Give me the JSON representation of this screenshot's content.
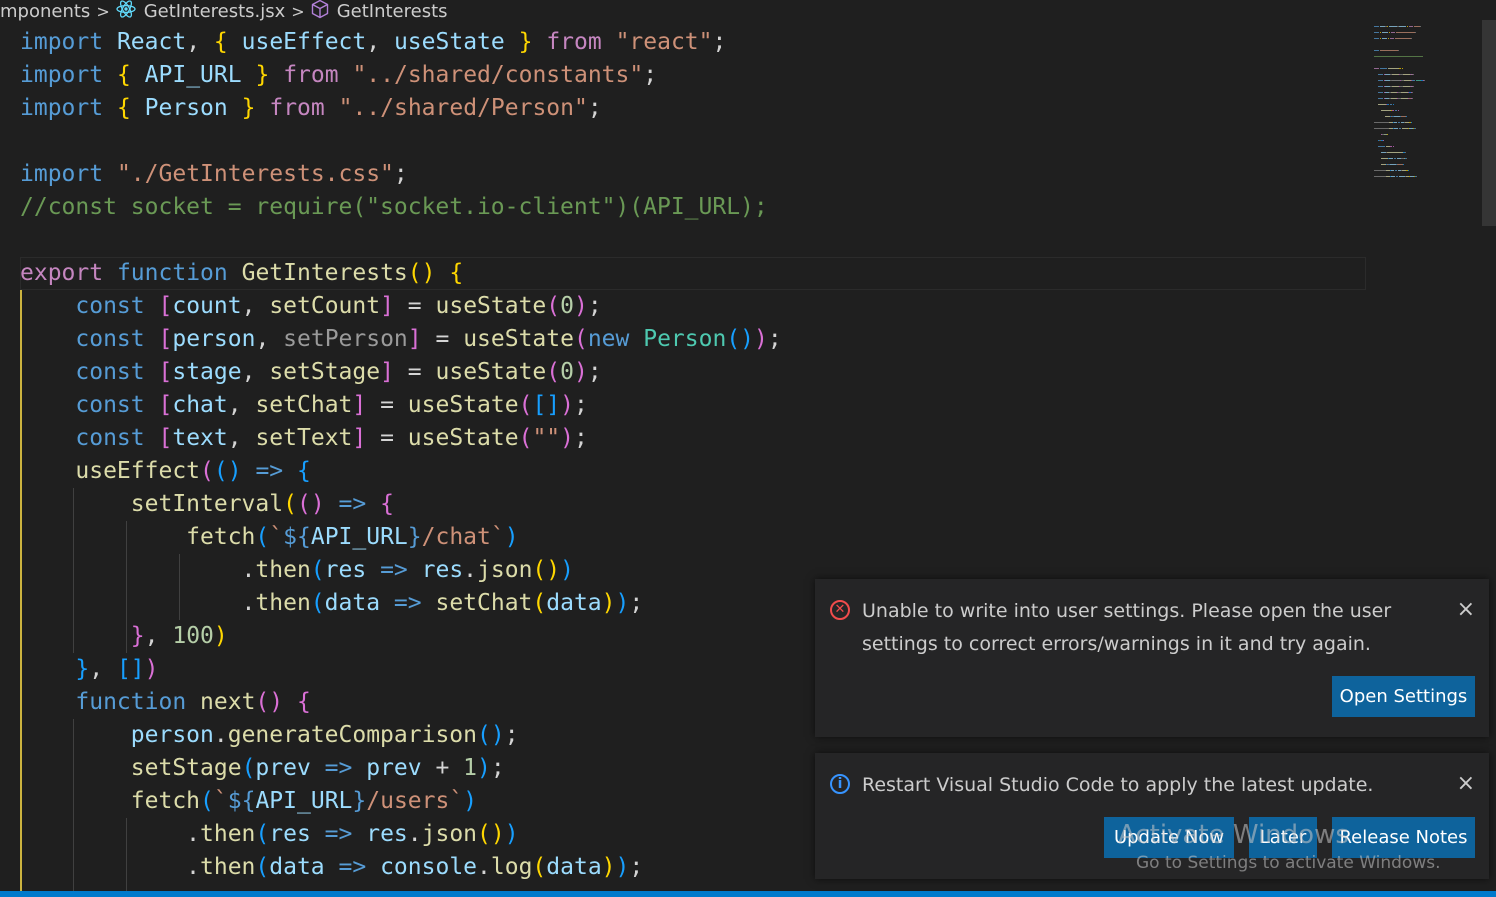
{
  "breadcrumb": {
    "folder": "mponents",
    "file": "GetInterests.jsx",
    "symbol": "GetInterests",
    "separator": ">"
  },
  "icons": {
    "file": "react-icon",
    "symbol": "cube-icon"
  },
  "colors": {
    "accent": "#007acc",
    "button": "#0e639c",
    "error": "#f14c4c",
    "info": "#3794ff"
  },
  "code_lines": [
    [
      [
        "k",
        "import"
      ],
      [
        "p",
        " "
      ],
      [
        "v",
        "React"
      ],
      [
        "p",
        ", "
      ],
      [
        "gold",
        "{"
      ],
      [
        "p",
        " "
      ],
      [
        "v",
        "useEffect"
      ],
      [
        "p",
        ", "
      ],
      [
        "v",
        "useState"
      ],
      [
        "p",
        " "
      ],
      [
        "gold",
        "}"
      ],
      [
        "p",
        " "
      ],
      [
        "c",
        "from"
      ],
      [
        "p",
        " "
      ],
      [
        "s",
        "\"react\""
      ],
      [
        "p",
        ";"
      ]
    ],
    [
      [
        "k",
        "import"
      ],
      [
        "p",
        " "
      ],
      [
        "gold",
        "{"
      ],
      [
        "p",
        " "
      ],
      [
        "v",
        "API_URL"
      ],
      [
        "p",
        " "
      ],
      [
        "gold",
        "}"
      ],
      [
        "p",
        " "
      ],
      [
        "c",
        "from"
      ],
      [
        "p",
        " "
      ],
      [
        "s",
        "\"../shared/constants\""
      ],
      [
        "p",
        ";"
      ]
    ],
    [
      [
        "k",
        "import"
      ],
      [
        "p",
        " "
      ],
      [
        "gold",
        "{"
      ],
      [
        "p",
        " "
      ],
      [
        "v",
        "Person"
      ],
      [
        "p",
        " "
      ],
      [
        "gold",
        "}"
      ],
      [
        "p",
        " "
      ],
      [
        "c",
        "from"
      ],
      [
        "p",
        " "
      ],
      [
        "s",
        "\"../shared/Person\""
      ],
      [
        "p",
        ";"
      ]
    ],
    [],
    [
      [
        "k",
        "import"
      ],
      [
        "p",
        " "
      ],
      [
        "s",
        "\"./GetInterests.css\""
      ],
      [
        "p",
        ";"
      ]
    ],
    [
      [
        "cm",
        "//const socket = require(\"socket.io-client\")(API_URL);"
      ]
    ],
    [],
    [
      [
        "c",
        "export"
      ],
      [
        "p",
        " "
      ],
      [
        "k",
        "function"
      ],
      [
        "p",
        " "
      ],
      [
        "f",
        "GetInterests"
      ],
      [
        "gold",
        "()"
      ],
      [
        "p",
        " "
      ],
      [
        "gold",
        "{"
      ]
    ],
    [
      [
        "p",
        "    "
      ],
      [
        "k",
        "const"
      ],
      [
        "p",
        " "
      ],
      [
        "pink",
        "["
      ],
      [
        "v",
        "count"
      ],
      [
        "p",
        ", "
      ],
      [
        "f",
        "setCount"
      ],
      [
        "pink",
        "]"
      ],
      [
        "p",
        " = "
      ],
      [
        "f",
        "useState"
      ],
      [
        "pink",
        "("
      ],
      [
        "n",
        "0"
      ],
      [
        "pink",
        ")"
      ],
      [
        "p",
        ";"
      ]
    ],
    [
      [
        "p",
        "    "
      ],
      [
        "k",
        "const"
      ],
      [
        "p",
        " "
      ],
      [
        "pink",
        "["
      ],
      [
        "v",
        "person"
      ],
      [
        "p",
        ", "
      ],
      [
        "dim",
        "setPerson"
      ],
      [
        "pink",
        "]"
      ],
      [
        "p",
        " = "
      ],
      [
        "f",
        "useState"
      ],
      [
        "pink",
        "("
      ],
      [
        "k",
        "new"
      ],
      [
        "p",
        " "
      ],
      [
        "t",
        "Person"
      ],
      [
        "lb",
        "()"
      ],
      [
        "pink",
        ")"
      ],
      [
        "p",
        ";"
      ]
    ],
    [
      [
        "p",
        "    "
      ],
      [
        "k",
        "const"
      ],
      [
        "p",
        " "
      ],
      [
        "pink",
        "["
      ],
      [
        "v",
        "stage"
      ],
      [
        "p",
        ", "
      ],
      [
        "f",
        "setStage"
      ],
      [
        "pink",
        "]"
      ],
      [
        "p",
        " = "
      ],
      [
        "f",
        "useState"
      ],
      [
        "pink",
        "("
      ],
      [
        "n",
        "0"
      ],
      [
        "pink",
        ")"
      ],
      [
        "p",
        ";"
      ]
    ],
    [
      [
        "p",
        "    "
      ],
      [
        "k",
        "const"
      ],
      [
        "p",
        " "
      ],
      [
        "pink",
        "["
      ],
      [
        "v",
        "chat"
      ],
      [
        "p",
        ", "
      ],
      [
        "f",
        "setChat"
      ],
      [
        "pink",
        "]"
      ],
      [
        "p",
        " = "
      ],
      [
        "f",
        "useState"
      ],
      [
        "pink",
        "("
      ],
      [
        "lb",
        "[]"
      ],
      [
        "pink",
        ")"
      ],
      [
        "p",
        ";"
      ]
    ],
    [
      [
        "p",
        "    "
      ],
      [
        "k",
        "const"
      ],
      [
        "p",
        " "
      ],
      [
        "pink",
        "["
      ],
      [
        "v",
        "text"
      ],
      [
        "p",
        ", "
      ],
      [
        "f",
        "setText"
      ],
      [
        "pink",
        "]"
      ],
      [
        "p",
        " = "
      ],
      [
        "f",
        "useState"
      ],
      [
        "pink",
        "("
      ],
      [
        "s",
        "\"\""
      ],
      [
        "pink",
        ")"
      ],
      [
        "p",
        ";"
      ]
    ],
    [
      [
        "p",
        "    "
      ],
      [
        "f",
        "useEffect"
      ],
      [
        "pink",
        "("
      ],
      [
        "lb",
        "()"
      ],
      [
        "p",
        " "
      ],
      [
        "k",
        "=>"
      ],
      [
        "p",
        " "
      ],
      [
        "lb",
        "{"
      ]
    ],
    [
      [
        "p",
        "        "
      ],
      [
        "f",
        "setInterval"
      ],
      [
        "gold",
        "("
      ],
      [
        "pink",
        "()"
      ],
      [
        "p",
        " "
      ],
      [
        "k",
        "=>"
      ],
      [
        "p",
        " "
      ],
      [
        "pink",
        "{"
      ]
    ],
    [
      [
        "p",
        "            "
      ],
      [
        "f",
        "fetch"
      ],
      [
        "lb",
        "("
      ],
      [
        "s",
        "`"
      ],
      [
        "k",
        "${"
      ],
      [
        "v",
        "API_URL"
      ],
      [
        "k",
        "}"
      ],
      [
        "s",
        "/chat`"
      ],
      [
        "lb",
        ")"
      ]
    ],
    [
      [
        "p",
        "                ."
      ],
      [
        "f",
        "then"
      ],
      [
        "lb",
        "("
      ],
      [
        "v",
        "res"
      ],
      [
        "p",
        " "
      ],
      [
        "k",
        "=>"
      ],
      [
        "p",
        " "
      ],
      [
        "v",
        "res"
      ],
      [
        "p",
        "."
      ],
      [
        "f",
        "json"
      ],
      [
        "gold",
        "()"
      ],
      [
        "lb",
        ")"
      ]
    ],
    [
      [
        "p",
        "                ."
      ],
      [
        "f",
        "then"
      ],
      [
        "lb",
        "("
      ],
      [
        "v",
        "data"
      ],
      [
        "p",
        " "
      ],
      [
        "k",
        "=>"
      ],
      [
        "p",
        " "
      ],
      [
        "f",
        "setChat"
      ],
      [
        "gold",
        "("
      ],
      [
        "v",
        "data"
      ],
      [
        "gold",
        ")"
      ],
      [
        "lb",
        ")"
      ],
      [
        "p",
        ";"
      ]
    ],
    [
      [
        "p",
        "        "
      ],
      [
        "pink",
        "}"
      ],
      [
        "p",
        ", "
      ],
      [
        "n",
        "100"
      ],
      [
        "gold",
        ")"
      ]
    ],
    [
      [
        "p",
        "    "
      ],
      [
        "lb",
        "}"
      ],
      [
        "p",
        ", "
      ],
      [
        "lb",
        "[]"
      ],
      [
        "pink",
        ")"
      ]
    ],
    [
      [
        "p",
        "    "
      ],
      [
        "k",
        "function"
      ],
      [
        "p",
        " "
      ],
      [
        "f",
        "next"
      ],
      [
        "pink",
        "()"
      ],
      [
        "p",
        " "
      ],
      [
        "pink",
        "{"
      ]
    ],
    [
      [
        "p",
        "        "
      ],
      [
        "v",
        "person"
      ],
      [
        "p",
        "."
      ],
      [
        "f",
        "generateComparison"
      ],
      [
        "lb",
        "()"
      ],
      [
        "p",
        ";"
      ]
    ],
    [
      [
        "p",
        "        "
      ],
      [
        "f",
        "setStage"
      ],
      [
        "lb",
        "("
      ],
      [
        "v",
        "prev"
      ],
      [
        "p",
        " "
      ],
      [
        "k",
        "=>"
      ],
      [
        "p",
        " "
      ],
      [
        "v",
        "prev"
      ],
      [
        "p",
        " + "
      ],
      [
        "n",
        "1"
      ],
      [
        "lb",
        ")"
      ],
      [
        "p",
        ";"
      ]
    ],
    [
      [
        "p",
        "        "
      ],
      [
        "f",
        "fetch"
      ],
      [
        "lb",
        "("
      ],
      [
        "s",
        "`"
      ],
      [
        "k",
        "${"
      ],
      [
        "v",
        "API_URL"
      ],
      [
        "k",
        "}"
      ],
      [
        "s",
        "/users`"
      ],
      [
        "lb",
        ")"
      ]
    ],
    [
      [
        "p",
        "            ."
      ],
      [
        "f",
        "then"
      ],
      [
        "lb",
        "("
      ],
      [
        "v",
        "res"
      ],
      [
        "p",
        " "
      ],
      [
        "k",
        "=>"
      ],
      [
        "p",
        " "
      ],
      [
        "v",
        "res"
      ],
      [
        "p",
        "."
      ],
      [
        "f",
        "json"
      ],
      [
        "gold",
        "()"
      ],
      [
        "lb",
        ")"
      ]
    ],
    [
      [
        "p",
        "            ."
      ],
      [
        "f",
        "then"
      ],
      [
        "lb",
        "("
      ],
      [
        "v",
        "data"
      ],
      [
        "p",
        " "
      ],
      [
        "k",
        "=>"
      ],
      [
        "p",
        " "
      ],
      [
        "v",
        "console"
      ],
      [
        "p",
        "."
      ],
      [
        "f",
        "log"
      ],
      [
        "gold",
        "("
      ],
      [
        "v",
        "data"
      ],
      [
        "gold",
        ")"
      ],
      [
        "lb",
        ")"
      ],
      [
        "p",
        ";"
      ]
    ]
  ],
  "notifications": {
    "error": {
      "message": "Unable to write into user settings. Please open the user settings to correct errors/warnings in it and try again.",
      "icon": "error-circle-icon",
      "button": "Open Settings",
      "close": "×"
    },
    "update": {
      "message": "Restart Visual Studio Code to apply the latest update.",
      "icon": "info-circle-icon",
      "buttons": [
        "Update Now",
        "Later",
        "Release Notes"
      ],
      "close": "×"
    }
  },
  "watermark": {
    "title": "Activate Windows",
    "subtitle": "Go to Settings to activate Windows."
  }
}
